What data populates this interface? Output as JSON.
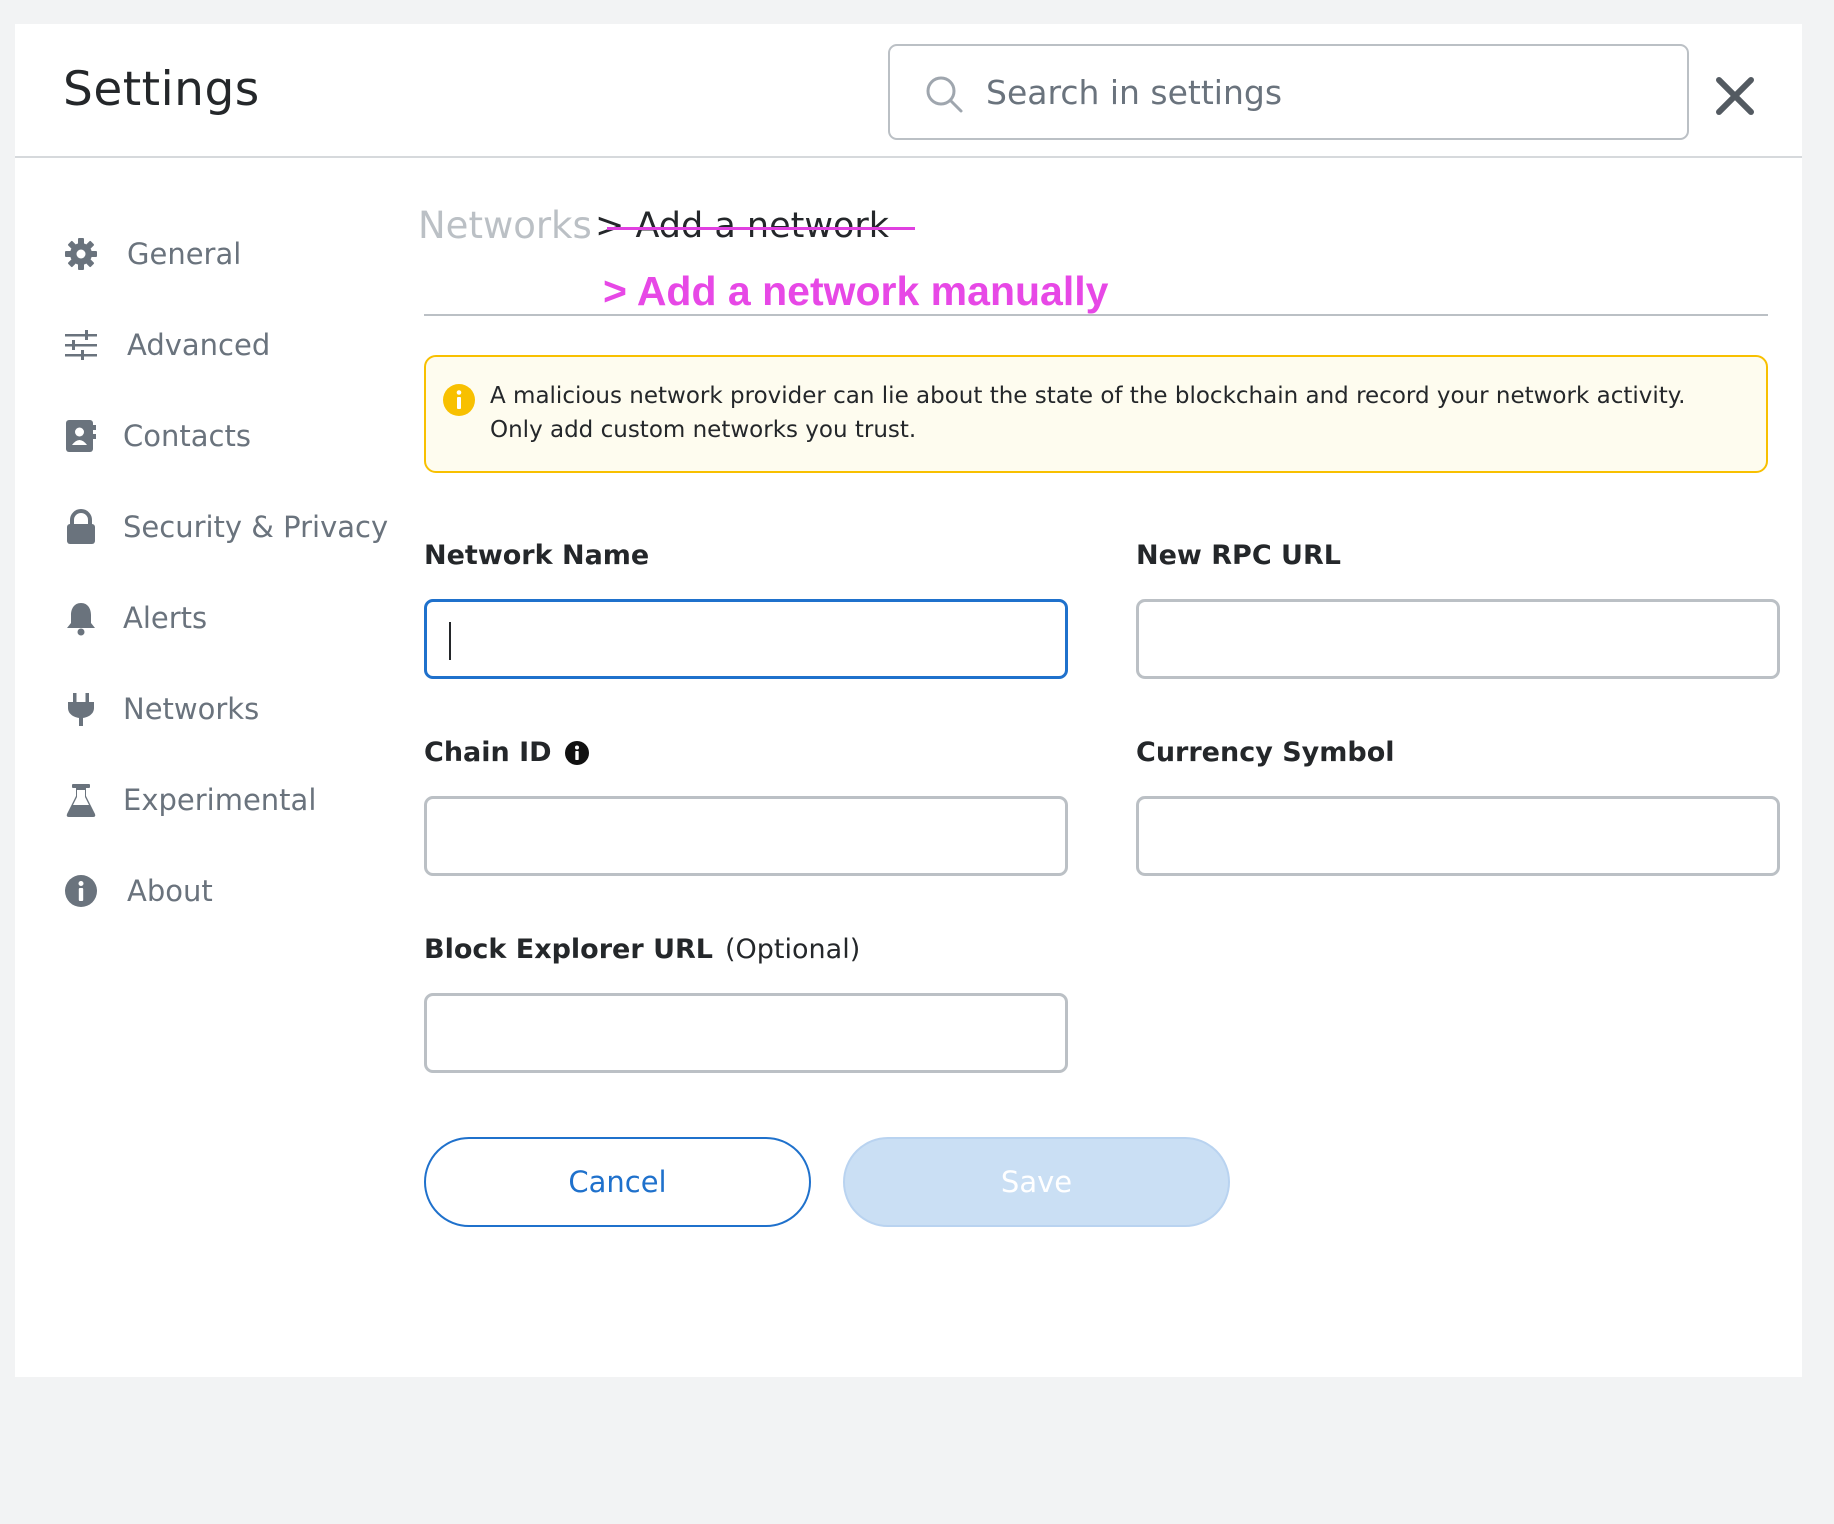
{
  "header": {
    "title": "Settings",
    "search_placeholder": "Search in settings"
  },
  "sidebar": {
    "items": [
      {
        "label": "General",
        "icon": "gear-icon"
      },
      {
        "label": "Advanced",
        "icon": "sliders-icon"
      },
      {
        "label": "Contacts",
        "icon": "contacts-book-icon"
      },
      {
        "label": "Security & Privacy",
        "icon": "lock-icon"
      },
      {
        "label": "Alerts",
        "icon": "bell-icon"
      },
      {
        "label": "Networks",
        "icon": "plug-icon"
      },
      {
        "label": "Experimental",
        "icon": "flask-icon"
      },
      {
        "label": "About",
        "icon": "info-icon"
      }
    ]
  },
  "breadcrumb": {
    "parent": "Networks",
    "current": "> Add a network",
    "annotation": "> Add a network manually"
  },
  "warning": {
    "text": "A malicious network provider can lie about the state of the blockchain and record your network activity. Only add custom networks you trust."
  },
  "form": {
    "network_name_label": "Network Name",
    "rpc_url_label": "New RPC URL",
    "chain_id_label": "Chain ID",
    "currency_symbol_label": "Currency Symbol",
    "block_explorer_label": "Block Explorer URL",
    "block_explorer_optional": "(Optional)",
    "network_name_value": "",
    "rpc_url_value": "",
    "chain_id_value": "",
    "currency_symbol_value": "",
    "block_explorer_value": ""
  },
  "actions": {
    "cancel_label": "Cancel",
    "save_label": "Save"
  },
  "colors": {
    "accent": "#1f71cc",
    "warning_border": "#f8c000",
    "warning_bg": "#fefcef",
    "annotation": "#e748e6",
    "save_disabled": "#cadff4"
  }
}
